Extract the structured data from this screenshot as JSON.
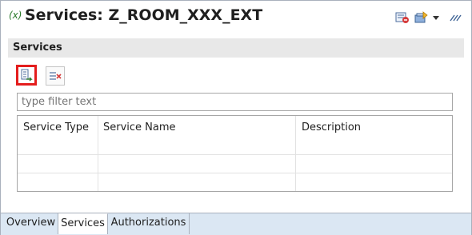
{
  "header": {
    "editor_icon": "(x)",
    "title": "Services: Z_ROOM_XXX_EXT"
  },
  "toolbar": {
    "icons": [
      "activate-icon",
      "publish-icon",
      "dropdown-arrow-icon",
      "more-icon"
    ]
  },
  "section": {
    "title": "Services"
  },
  "actions": {
    "add_icon": "add-service-icon",
    "remove_icon": "remove-service-icon"
  },
  "filter": {
    "placeholder": "type filter text"
  },
  "table": {
    "columns": [
      "Service Type",
      "Service Name",
      "Description"
    ],
    "rows": []
  },
  "tabs": [
    {
      "label": "Overview",
      "active": false
    },
    {
      "label": "Services",
      "active": true
    },
    {
      "label": "Authorizations",
      "active": false
    }
  ],
  "colors": {
    "highlight_border": "#e41d1d",
    "tab_strip": "#dbe7f3",
    "section_bar": "#e8e8e8"
  }
}
